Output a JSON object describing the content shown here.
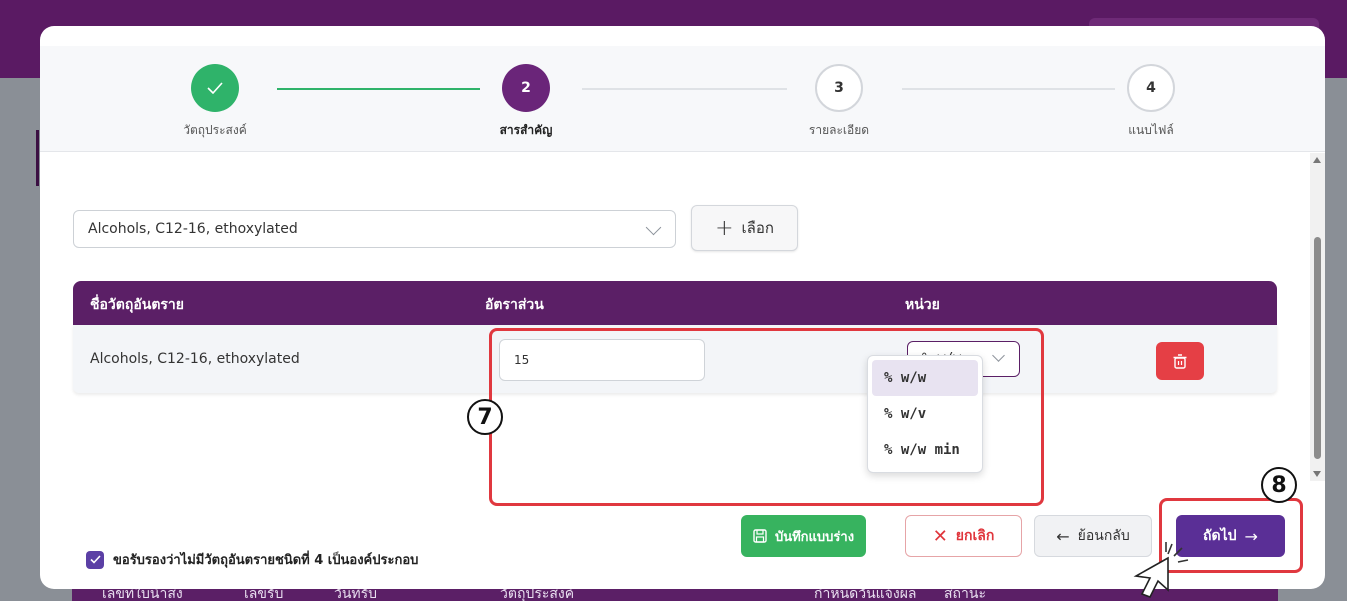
{
  "steps": [
    {
      "number": "",
      "label": "วัตถุประสงค์",
      "state": "done"
    },
    {
      "number": "2",
      "label": "สารสำคัญ",
      "state": "active"
    },
    {
      "number": "3",
      "label": "รายละเอียด",
      "state": "todo"
    },
    {
      "number": "4",
      "label": "แนบไฟล์",
      "state": "todo"
    }
  ],
  "substance_select": {
    "value": "Alcohols, C12-16, ethoxylated"
  },
  "add_button": {
    "label": "เลือก"
  },
  "table": {
    "headers": [
      "ชื่อวัตถุอันตราย",
      "อัตราส่วน",
      "หน่วย"
    ],
    "row": {
      "name": "Alcohols, C12-16, ethoxylated",
      "ratio": "15",
      "unit": "% w/w"
    }
  },
  "unit_options": [
    "% w/w",
    "% w/v",
    "% w/w min"
  ],
  "confirm_checkbox": {
    "label": "ขอรับรองว่าไม่มีวัตถุอันตรายชนิดที่ 4 เป็นองค์ประกอบ",
    "checked": true
  },
  "footer": {
    "save_draft": "บันทึกแบบร่าง",
    "cancel": "ยกเลิก",
    "back": "ย้อนกลับ",
    "next": "ถัดไป"
  },
  "annotations": {
    "box7": "7",
    "box8": "8"
  },
  "background_table_headers": [
    "เลขที่ใบนำส่ง",
    "เลขรับ",
    "วันที่รับ",
    "วัตถุประสงค์",
    "กำหนดวันแจ้งผล",
    "สถานะ"
  ],
  "colors": {
    "primary": "#5b1f66",
    "success": "#37b35f",
    "danger": "#e53f45",
    "accent": "#5a2f96",
    "annotation": "#e0383f"
  }
}
